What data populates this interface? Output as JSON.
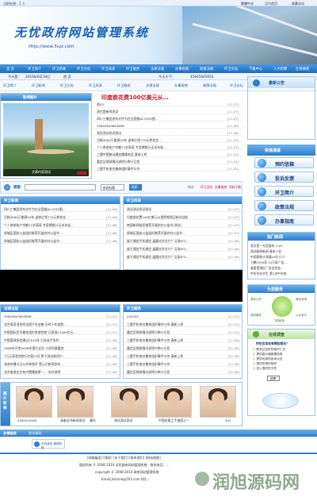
{
  "topbar": {
    "left": "当前在线：1 人",
    "items": [
      "繁體中文",
      "设为首页",
      "收藏本站"
    ]
  },
  "banner": {
    "title": "无忧政府网站管理系统",
    "url": "Http://www.5ujz.com"
  },
  "nav": {
    "items": [
      "首 页",
      "环卫简介",
      "环卫新闻",
      "环卫文化",
      "环卫风采",
      "环卫服务",
      "法律法规",
      "办事指南",
      "政策法规",
      "环卫论坛",
      "下载中心",
      "人才招聘",
      "在线调查"
    ]
  },
  "datebar": {
    "today_label": "今天是：",
    "date": "2010年6月19日",
    "home": "首 页",
    "weather_label": "今天天气：",
    "ticker": "45645645654"
  },
  "qnav": {
    "items": [
      "环卫简介",
      "环卫新闻",
      "环卫文化",
      "环卫风采",
      "环卫服务",
      "法律法规",
      "办事指南",
      "政策法规",
      "环卫论坛"
    ]
  },
  "slide": {
    "title": "新闻图片",
    "caption": "文章内容测试"
  },
  "headline": {
    "title": "印度欲花费100亿美元从…"
  },
  "news": [
    {
      "t": "测43",
      "d": "[11-07]"
    },
    {
      "t": "测它是新闻测试",
      "d": "[11-07]"
    },
    {
      "t": "四川丁集团发布文件为在全国推ACCESS图…",
      "d": "[11-07]"
    },
    {
      "t": "45645645645656",
      "d": "[11-06]"
    },
    {
      "t": "测试测试测试测试",
      "d": "[11-06]"
    },
    {
      "t": "月耗4000万能源10年 退休后领770元养老金…",
      "d": "[11-05]"
    },
    {
      "t": "个人养老账户余额72岁高寿 专家揭统计无关年轻…",
      "d": "[11-05]"
    },
    {
      "t": "三鹿中国移动通信爆满电话 真新上桥",
      "d": "[11-05]"
    },
    {
      "t": "嘉定区财政情况说明与审计日程",
      "d": "[11-05]"
    },
    {
      "t": "三鹿手机电台集体组织事件与你",
      "d": "[11-05]"
    }
  ],
  "search": {
    "label": "搜索",
    "placeholder": "",
    "select": "新闻标题",
    "button": "搜索",
    "links": [
      "热点：",
      "环卫业务",
      "办事指南",
      "资料下载"
    ]
  },
  "news_left": {
    "title": "环卫新闻",
    "rows": [
      {
        "t": "四川丁集团发布文件为在全国推ACCESS图…",
        "d": "[11-06]"
      },
      {
        "t": "月耗4000万能源10年 退休后领770元养老金…",
        "d": "[11-06]"
      },
      {
        "t": "个人养老账户余额72岁高寿 专家揭统计无关年轻…",
        "d": "[11-06]"
      },
      {
        "t": "周城区国务公益组织推荐开展农村公益节…",
        "d": "[11-06]"
      },
      {
        "t": "周城区国务公益组织推荐开展农村公益节…",
        "d": "[11-06]"
      }
    ]
  },
  "news_right": {
    "title": "环卫风采",
    "rows": [
      {
        "t": "测试测试测试测试",
        "d": "[11-07]"
      },
      {
        "t": "印度欲花费100亿美元从俄罗斯购买新式战机",
        "d": "[11-07]"
      },
      {
        "t": "南国新闻组织推荐开展农村公益节(测试)",
        "d": "[11-07]"
      },
      {
        "t": "周城区国务公益组织推荐开展农村公益节…",
        "d": "[11-07]"
      },
      {
        "t": "量子通信手机通信 晶圆光学芯片广泛测AT3…",
        "d": "[11-06]"
      },
      {
        "t": "量子通信手机通信 晶圆光学芯片广泛测AT3…",
        "d": "[11-06]"
      },
      {
        "t": "量子通信手机通信 晶圆光学芯片广泛测AT3…",
        "d": "[11-06]"
      }
    ]
  },
  "law": {
    "title": "法律法规",
    "rows": [
      {
        "t": "45645645645656",
        "d": "[11-07]"
      },
      {
        "t": "北京离奇消失的法国千年宝箱 历时十年追踪…",
        "d": "[11-07]"
      },
      {
        "t": "中国国际货币基金组织发放贷款 已获准11000亿元…",
        "d": "[11-07]"
      },
      {
        "t": "中国篮球协会通过2010年 日本选手失利",
        "d": "[11-06]"
      },
      {
        "t": "2006年开发2006年银行全员 小孩同意嘉宾",
        "d": "[11-06]"
      },
      {
        "t": "7万元高息贷款行村国人同 骨干测试新用户…",
        "d": "[11-06]"
      },
      {
        "t": "海滨市播卡日公司单独开 受认识新闻发布…",
        "d": "[11-06]"
      },
      {
        "t": "北京旅游业后有内置播放第一… 另外说明",
        "d": "[11-06]"
      }
    ]
  },
  "service": {
    "title": "环卫服务",
    "rows": [
      {
        "t": "454545",
        "d": "[11-07]"
      },
      {
        "t": "三鹿手机电台集体组织事件与你 真新上桥",
        "d": "[11-07]"
      },
      {
        "t": "嘉定区财政情况说明与审计日程",
        "d": "[11-07]"
      },
      {
        "t": "三鹿手机电台集体组织事件与你 真新上桥",
        "d": "[11-06]"
      },
      {
        "t": "嘉定区财政情况说明与审计日程",
        "d": "[11-06]"
      },
      {
        "t": "三鹿手机电台集体组织事件与你 真新上桥",
        "d": "[11-06]"
      },
      {
        "t": "三鹿手机电台集体组织事件与你",
        "d": "[11-06]"
      },
      {
        "t": "嘉定区财政情况说明与审计日程",
        "d": "[11-06]"
      }
    ]
  },
  "gallery": {
    "title": "图片新闻",
    "items": [
      "4564554545",
      "清鉴佳书新闻测试",
      "测试测试",
      "摩托",
      "测试测试测试",
      "中国花瓶之手借固之一",
      "541"
    ]
  },
  "right": {
    "notice_title": "最新公告",
    "quick_title": "快速通道",
    "quick": [
      "预约信箱",
      "投诉反馈",
      "环卫简介",
      "政策法规",
      "办事指南"
    ],
    "hot_title": "热门新闻",
    "hot": [
      "张文是一号里面的 1:55",
      "测试新闻新闻 真有人在",
      "中国高铁计测通10亿人口",
      "力鹏1000家 10万条广告…",
      "道爱是地区广告信息会…",
      "中学毕业学生 第1次中学校"
    ],
    "svc_title": "为您服务",
    "svc_items": [
      "政务公开",
      "政务咨询",
      "政府服务",
      "公众参与",
      "飞机航线"
    ],
    "poll_title": "在线调查",
    "poll_question": "你在这本站有哪些想法？",
    "poll_options": [
      "联系过这样的组织工作",
      "提供高价值数据信息",
      "提供优秀的技术大全",
      "提供的很好组织",
      "进入很好的文件"
    ],
    "poll_button": "投票"
  },
  "links": {
    "title": "友情链接",
    "more": "更多精彩",
    "logo_text": "无忧政府 管理系统"
  },
  "footer": {
    "line1": "[网络备案] [版权] [关于我们] [联系我们] [网站地图]",
    "line2": "版权所有 © 2008-2010 无忧政府网站管理系统 - 联系电话：…",
    "line3": "copyright © 2008-2010 政府网站管理系统",
    "line4": "Email:jkhome@163.com QQ:…"
  },
  "watermark": "润旭源码网",
  "colors": {
    "primary": "#1a6ac0",
    "accent_red": "#c8102e",
    "light": "#e8f1fb"
  }
}
